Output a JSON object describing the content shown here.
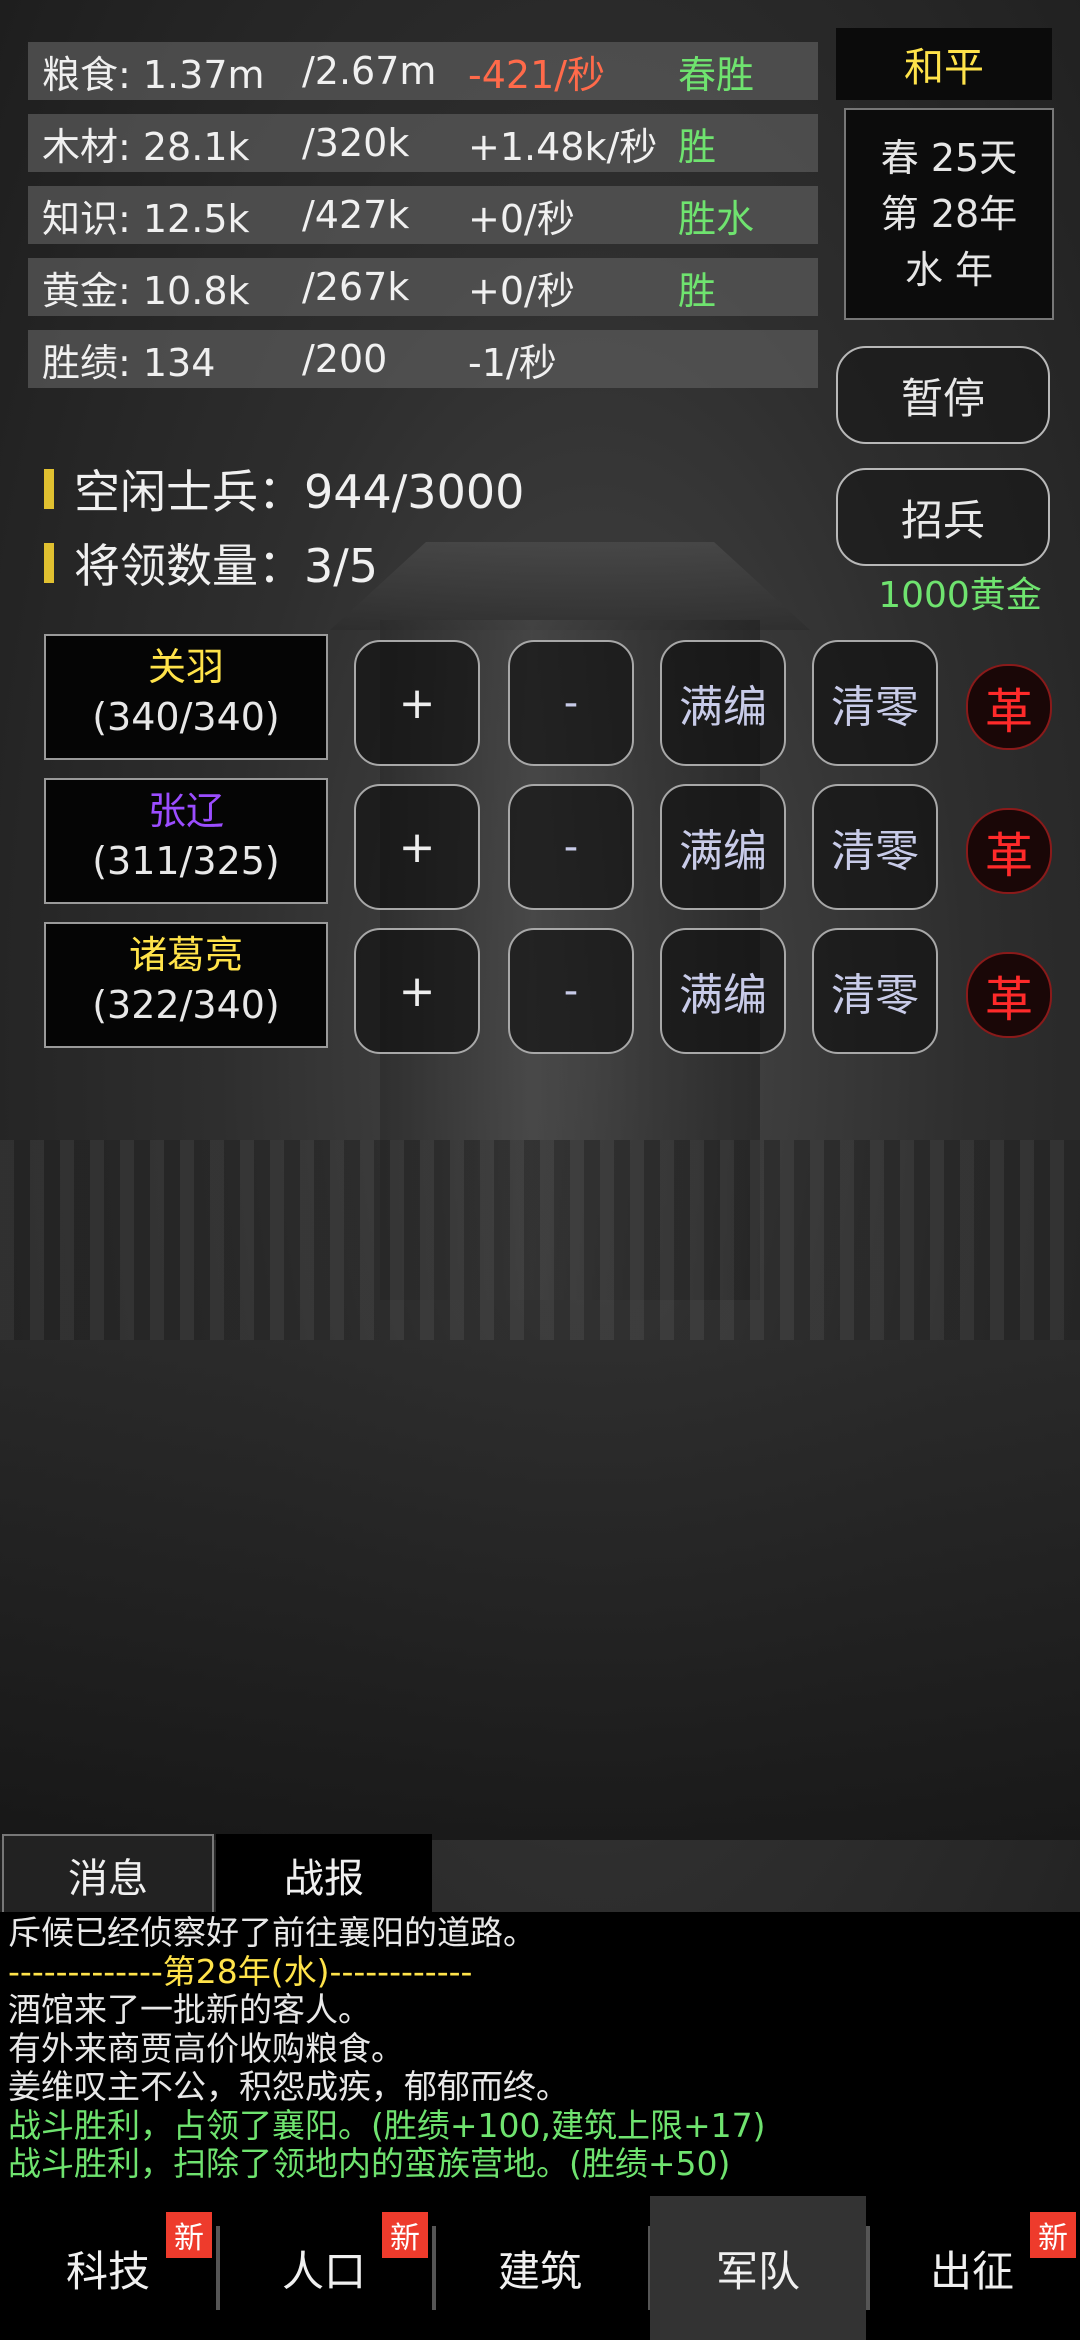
{
  "resources": [
    {
      "name": "粮食: 1.37m",
      "cap": "/2.67m",
      "rate": "-421/秒",
      "tag": "春胜",
      "negative": true
    },
    {
      "name": "木材: 28.1k",
      "cap": "/320k",
      "rate": "+1.48k/秒",
      "tag": "胜",
      "negative": false
    },
    {
      "name": "知识: 12.5k",
      "cap": "/427k",
      "rate": "+0/秒",
      "tag": "胜水",
      "negative": false
    },
    {
      "name": "黄金: 10.8k",
      "cap": "/267k",
      "rate": "+0/秒",
      "tag": "胜",
      "negative": false
    },
    {
      "name": "胜绩: 134",
      "cap": "/200",
      "rate": "-1/秒",
      "tag": "",
      "negative": false
    }
  ],
  "status": {
    "peace": "和平",
    "date_line1": "春 25天",
    "date_line2": "第 28年",
    "date_line3": "水 年"
  },
  "buttons": {
    "pause": "暂停",
    "recruit": "招兵",
    "recruit_cost": "1000黄金"
  },
  "army": {
    "idle_soldiers": "空闲士兵：944/3000",
    "general_count": "将领数量：3/5"
  },
  "generals": [
    {
      "name": "关羽",
      "troops": "(340/340)",
      "color": "#ffe34a"
    },
    {
      "name": "张辽",
      "troops": "(311/325)",
      "color": "#9b4dff"
    },
    {
      "name": "诸葛亮",
      "troops": "(322/340)",
      "color": "#ffe34a"
    }
  ],
  "general_actions": {
    "plus": "+",
    "minus": "-",
    "fill": "满编",
    "clear": "清零",
    "reform": "革"
  },
  "tabs": {
    "messages": "消息",
    "battle_report": "战报"
  },
  "log": [
    {
      "text": "斥候已经侦察好了前往襄阳的道路。",
      "style": "white"
    },
    {
      "text": "-------------第28年(水)------------",
      "style": "yellow"
    },
    {
      "text": "酒馆来了一批新的客人。",
      "style": "white"
    },
    {
      "text": "有外来商贾高价收购粮食。",
      "style": "white"
    },
    {
      "text": "姜维叹主不公，积怨成疾，郁郁而终。",
      "style": "white"
    },
    {
      "text": "战斗胜利，占领了襄阳。(胜绩+100,建筑上限+17)",
      "style": "green"
    },
    {
      "text": "战斗胜利，扫除了领地内的蛮族营地。(胜绩+50)",
      "style": "green"
    }
  ],
  "nav": [
    {
      "label": "科技",
      "badge": "新"
    },
    {
      "label": "人口",
      "badge": "新"
    },
    {
      "label": "建筑",
      "badge": ""
    },
    {
      "label": "军队",
      "badge": ""
    },
    {
      "label": "出征",
      "badge": "新"
    }
  ],
  "active_nav": "军队"
}
